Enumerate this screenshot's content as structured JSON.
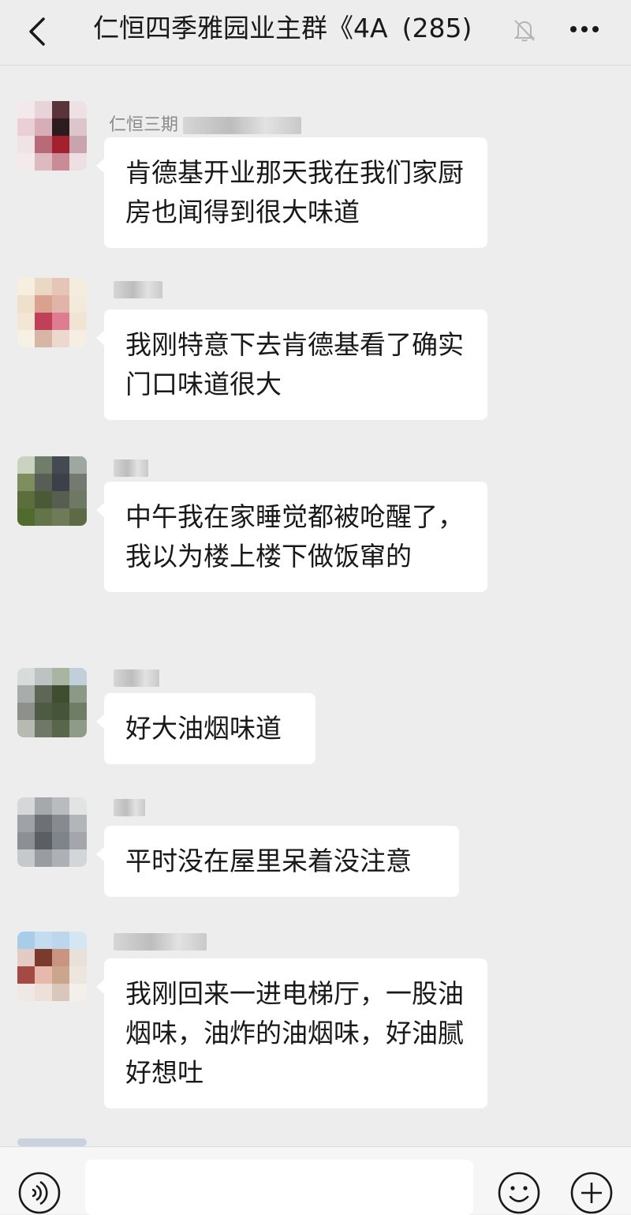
{
  "header": {
    "title": "仁恒四季雅园业主群《4A",
    "member_count": "(285)",
    "back_icon": "chevron-left-icon",
    "mute_icon": "bell-off-icon",
    "more_icon": "more-dots-icon"
  },
  "messages": [
    {
      "sender": "仁恒三期",
      "text": "肯德基开业那天我在我们家厨房也闻得到很大味道"
    },
    {
      "sender": "",
      "text": "我刚特意下去肯德基看了确实门口味道很大"
    },
    {
      "sender": "",
      "text": "中午我在家睡觉都被呛醒了，我以为楼上楼下做饭窜的"
    },
    {
      "sender": "",
      "text": "好大油烟味道"
    },
    {
      "sender": "",
      "text": "平时没在屋里呆着没注意"
    },
    {
      "sender": "",
      "text": "我刚回来一进电梯厅，一股油烟味，油炸的油烟味，好油腻好想吐"
    }
  ],
  "input_bar": {
    "voice_icon": "voice-icon",
    "emoji_icon": "emoji-icon",
    "plus_icon": "plus-icon",
    "input_value": ""
  },
  "colors": {
    "background": "#ededed",
    "bubble": "#ffffff",
    "text": "#191919",
    "sender_name": "#8a8a8a"
  }
}
